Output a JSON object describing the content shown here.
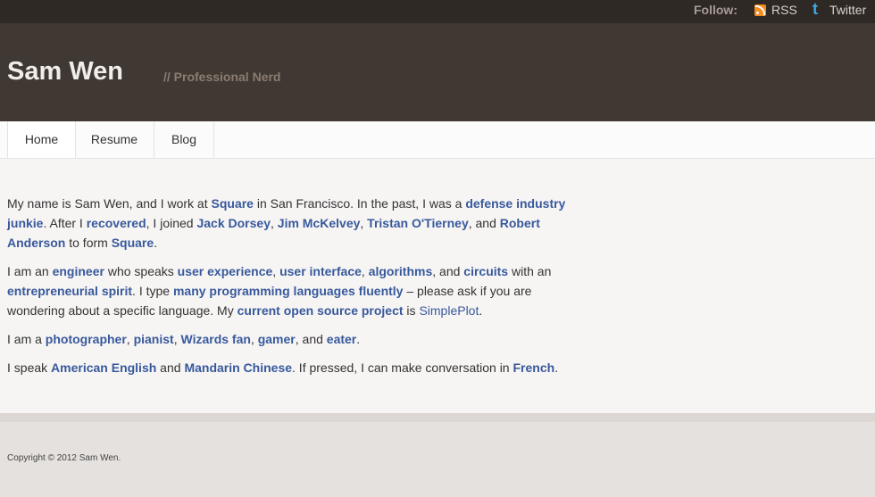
{
  "topbar": {
    "follow_label": "Follow:",
    "rss_label": "RSS",
    "twitter_label": "Twitter",
    "rss_icon": "rss-icon",
    "twitter_icon": "twitter-icon"
  },
  "header": {
    "title": "Sam Wen",
    "tagline": "// Professional Nerd"
  },
  "nav": {
    "items": [
      {
        "label": "Home"
      },
      {
        "label": "Resume"
      },
      {
        "label": "Blog"
      }
    ]
  },
  "content": {
    "p1": {
      "t1": "My name is Sam Wen, and I work at ",
      "l1": "Square",
      "t2": " in San Francisco. In the past, I was a ",
      "l2": "defense industry junkie",
      "t3": ". After I ",
      "l3": "recovered",
      "t4": ", I joined ",
      "l4": "Jack Dorsey",
      "t5": ", ",
      "l5": "Jim McKelvey",
      "t6": ", ",
      "l6": "Tristan O'Tierney",
      "t7": ", and ",
      "l7": "Robert Anderson",
      "t8": " to form ",
      "l8": "Square",
      "t9": "."
    },
    "p2": {
      "t1": "I am an ",
      "l1": "engineer",
      "t2": " who speaks ",
      "l2": "user experience",
      "t3": ", ",
      "l3": "user interface",
      "t4": ", ",
      "l4": "algorithms",
      "t5": ", and ",
      "l5": "circuits",
      "t6": " with an ",
      "l6": "entrepreneurial spirit",
      "t7": ". I type ",
      "l7": "many programming languages fluently",
      "t8": " – please ask if you are wondering about a specific language. My ",
      "l8": "current open source project",
      "t9": " is ",
      "l9": "SimplePlot",
      "t10": "."
    },
    "p3": {
      "t1": "I am a ",
      "l1": "photographer",
      "t2": ", ",
      "l2": "pianist",
      "t3": ", ",
      "l3": "Wizards fan",
      "t4": ", ",
      "l4": "gamer",
      "t5": ", and ",
      "l5": "eater",
      "t6": "."
    },
    "p4": {
      "t1": "I speak ",
      "l1": "American English",
      "t2": " and ",
      "l2": "Mandarin Chinese",
      "t3": ". If pressed, I can make conversation in ",
      "l3": "French",
      "t4": "."
    }
  },
  "footer": {
    "copyright": "Copyright © 2012 Sam Wen."
  }
}
